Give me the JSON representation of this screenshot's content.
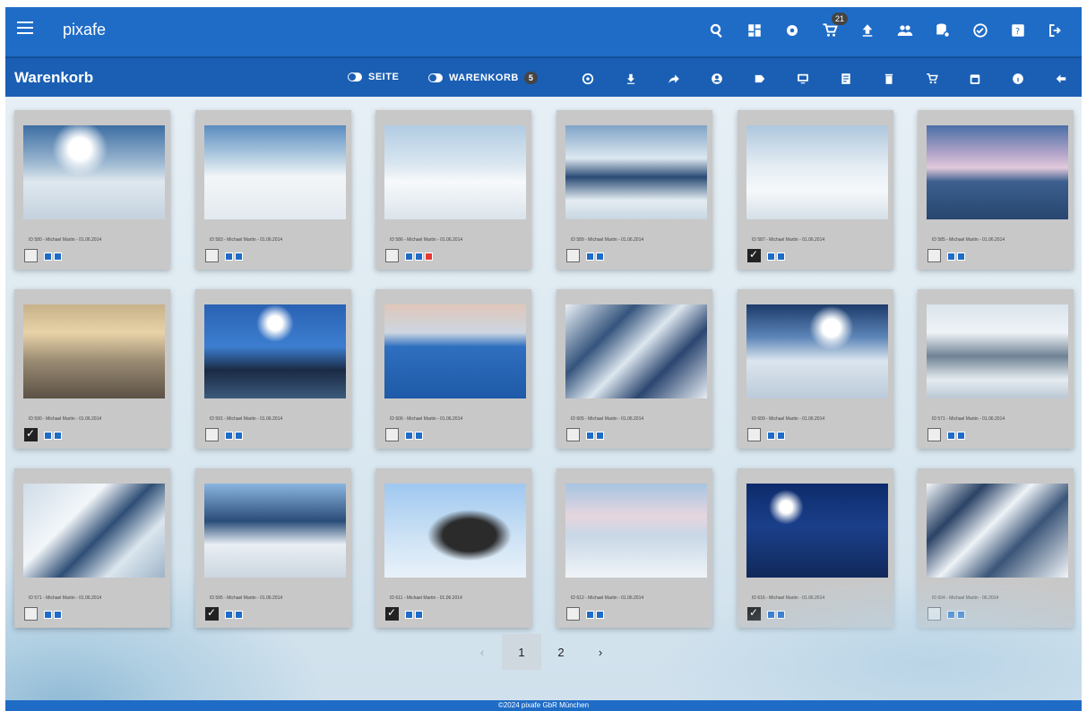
{
  "app": {
    "brand": "pixafe",
    "cart_count": "21"
  },
  "subbar": {
    "title": "Warenkorb",
    "toggle_page": "SEITE",
    "toggle_cart": "WARENKORB",
    "cart_items_badge": "5"
  },
  "top_icons": [
    "search-icon",
    "dashboard-icon",
    "settings-icon",
    "cart-icon",
    "upload-icon",
    "users-icon",
    "database-settings-icon",
    "check-circle-icon",
    "help-icon",
    "logout-icon"
  ],
  "sub_icons": [
    "close-circle-icon",
    "download-icon",
    "share-icon",
    "person-icon",
    "label-icon",
    "monitor-icon",
    "document-icon",
    "delete-icon",
    "remove-cart-icon",
    "calendar-icon",
    "info-icon",
    "back-arrow-icon"
  ],
  "cards": [
    {
      "caption": "ID 580 - Michael Martin - 01.06.2014",
      "checked": false,
      "red": false,
      "photo": "snow-sun-camp"
    },
    {
      "caption": "ID 583 - Michael Martin - 01.06.2014",
      "checked": false,
      "red": false,
      "photo": "snow-climber"
    },
    {
      "caption": "ID 586 - Michael Martin - 01.06.2014",
      "checked": false,
      "red": true,
      "photo": "snow-ridge"
    },
    {
      "caption": "ID 589 - Michael Martin - 01.06.2014",
      "checked": false,
      "red": false,
      "photo": "ice-aerial"
    },
    {
      "caption": "ID 587 - Michael Martin - 01.06.2014",
      "checked": true,
      "red": false,
      "photo": "snow-seated"
    },
    {
      "caption": "ID 585 - Michael Martin - 01.06.2014",
      "checked": false,
      "red": false,
      "photo": "pink-mountains"
    },
    {
      "caption": "ID 590 - Michael Martin - 01.06.2014",
      "checked": true,
      "red": false,
      "photo": "golden-ice"
    },
    {
      "caption": "ID 591 - Michael Martin - 01.06.2014",
      "checked": false,
      "red": false,
      "photo": "blue-sun-sea"
    },
    {
      "caption": "ID 606 - Michael Martin - 01.06.2014",
      "checked": false,
      "red": false,
      "photo": "blue-horizon"
    },
    {
      "caption": "ID 605 - Michael Martin - 01.06.2014",
      "checked": false,
      "red": false,
      "photo": "glacier-aerial"
    },
    {
      "caption": "ID 609 - Michael Martin - 01.06.2014",
      "checked": false,
      "red": false,
      "photo": "blue-sunset-ice"
    },
    {
      "caption": "ID 571 - Michael Martin - 01.06.2014",
      "checked": false,
      "red": false,
      "photo": "ice-field"
    },
    {
      "caption": "ID 571 - Michael Martin - 01.06.2014",
      "checked": false,
      "red": false,
      "photo": "glacier-cliff"
    },
    {
      "caption": "ID 595 - Michael Martin - 01.06.2014",
      "checked": true,
      "red": false,
      "photo": "climber-red"
    },
    {
      "caption": "ID 611 - Michael Martin - 01.06.2014",
      "checked": true,
      "red": false,
      "photo": "husky"
    },
    {
      "caption": "ID 612 - Michael Martin - 01.06.2014",
      "checked": false,
      "red": false,
      "photo": "sled-tundra"
    },
    {
      "caption": "ID 616 - Michael Martin - 01.06.2014",
      "checked": true,
      "red": false,
      "photo": "night-dogs"
    },
    {
      "caption": "ID 604 - Michael Martin - 06.2014",
      "checked": false,
      "red": false,
      "photo": "pack-ice"
    }
  ],
  "pagination": {
    "prev": "‹",
    "pages": [
      "1",
      "2"
    ],
    "next": "›",
    "active": "1"
  },
  "footer": "©2024 pixafe GbR München"
}
